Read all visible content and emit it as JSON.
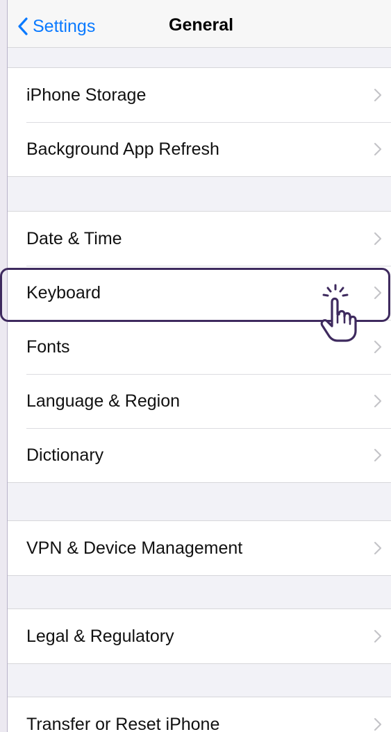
{
  "navbar": {
    "back_label": "Settings",
    "title": "General"
  },
  "groups": [
    {
      "items": [
        "iPhone Storage",
        "Background App Refresh"
      ]
    },
    {
      "items": [
        "Date & Time",
        "Keyboard",
        "Fonts",
        "Language & Region",
        "Dictionary"
      ]
    },
    {
      "items": [
        "VPN & Device Management"
      ]
    },
    {
      "items": [
        "Legal & Regulatory"
      ]
    },
    {
      "items": [
        "Transfer or Reset iPhone"
      ]
    }
  ],
  "highlighted_item": "Keyboard",
  "colors": {
    "accent": "#0a7aff",
    "highlight_border": "#3e2a5e",
    "background": "#f2f2f7"
  },
  "icons": [
    "chevron-left-icon",
    "chevron-right-icon",
    "tap-hand-icon"
  ]
}
